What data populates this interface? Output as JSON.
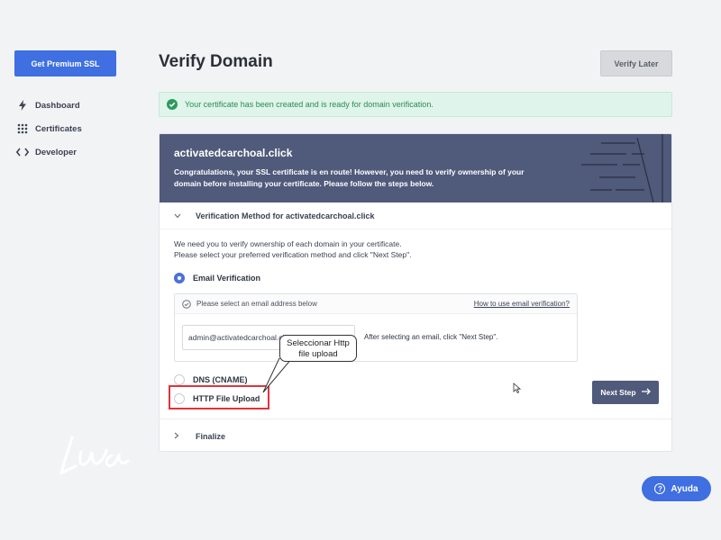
{
  "sidebar": {
    "premium_button": "Get Premium SSL",
    "items": [
      {
        "label": "Dashboard",
        "icon": "bolt-icon"
      },
      {
        "label": "Certificates",
        "icon": "grid-icon"
      },
      {
        "label": "Developer",
        "icon": "code-icon"
      }
    ]
  },
  "header": {
    "title": "Verify Domain",
    "verify_later": "Verify Later"
  },
  "alert": {
    "text": "Your certificate has been created and is ready for domain verification.",
    "icon": "check-circle-icon",
    "color": "#2d8a55"
  },
  "card": {
    "domain": "activatedcarchoal.click",
    "hero_text": "Congratulations, your SSL certificate is en route! However, you need to verify ownership of your domain before installing your certificate. Please follow the steps below.",
    "section_title": "Verification Method for activatedcarchoal.click",
    "intro_line1": "We need you to verify ownership of each domain in your certificate.",
    "intro_line2": "Please select your preferred verification method and click \"Next Step\".",
    "methods": [
      {
        "label": "Email Verification",
        "selected": true
      },
      {
        "label": "DNS (CNAME)",
        "selected": false
      },
      {
        "label": "HTTP File Upload",
        "selected": false
      }
    ],
    "email_box": {
      "prompt": "Please select an email address below",
      "help_link": "How to use email verification?",
      "selected_email": "admin@activatedcarchoal.click",
      "hint": "After selecting an email, click \"Next Step\"."
    },
    "next_button": "Next Step",
    "finalize": "Finalize"
  },
  "annotation": {
    "callout_line1": "Seleccionar Http",
    "callout_line2": "file upload",
    "highlight_color": "#e0333b"
  },
  "help_button": "Ayuda",
  "colors": {
    "accent": "#3f6fe0",
    "hero": "#505a7a"
  }
}
